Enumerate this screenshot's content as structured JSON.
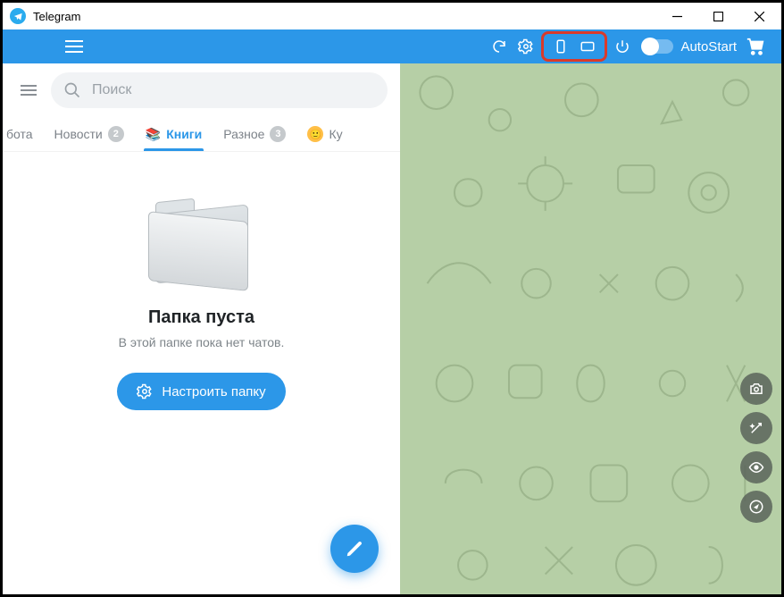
{
  "window": {
    "title": "Telegram"
  },
  "appbar": {
    "autostart_label": "AutoStart",
    "autostart_on": false
  },
  "search": {
    "placeholder": "Поиск"
  },
  "tabs": {
    "items": [
      {
        "label": "бота",
        "badge": null,
        "active": false,
        "truncated": "left"
      },
      {
        "label": "Новости",
        "badge": "2",
        "active": false
      },
      {
        "label": "Книги",
        "badge": null,
        "active": true,
        "emoji": "📚"
      },
      {
        "label": "Разное",
        "badge": "3",
        "active": false
      },
      {
        "label": "Ку",
        "badge": null,
        "active": false,
        "truncated": "right",
        "avatar": true
      }
    ]
  },
  "empty": {
    "title": "Папка пуста",
    "subtitle": "В этой папке пока нет чатов.",
    "button": "Настроить папку"
  },
  "side_actions": [
    "camera-icon",
    "magic-icon",
    "eye-icon",
    "compass-icon"
  ]
}
